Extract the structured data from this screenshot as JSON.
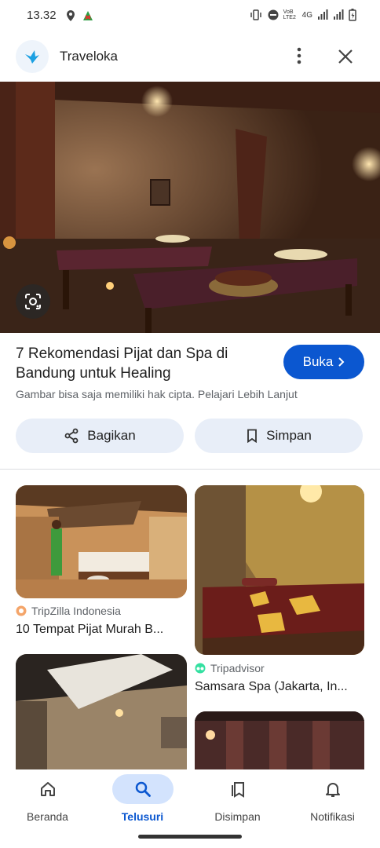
{
  "status_bar": {
    "time": "13.32",
    "network": "4G",
    "volte": "VoB LTE2"
  },
  "header": {
    "site_name": "Traveloka",
    "logo_icon": "traveloka-bird-icon"
  },
  "result": {
    "title": "7 Rekomendasi Pijat dan Spa di Bandung untuk Healing",
    "visit_label": "Buka",
    "copyright_note": "Gambar bisa saja memiliki hak cipta. Pelajari Lebih Lanjut",
    "share_label": "Bagikan",
    "save_label": "Simpan"
  },
  "related": [
    {
      "source": "TripZilla Indonesia",
      "title": "10 Tempat Pijat Murah B...",
      "source_color": "#f4a56a"
    },
    {
      "source": "Tripadvisor",
      "title": "Samsara Spa (Jakarta, In...",
      "source_color": "#34e0a1"
    }
  ],
  "bottom_nav": [
    {
      "label": "Beranda",
      "icon": "home-icon"
    },
    {
      "label": "Telusuri",
      "icon": "search-icon"
    },
    {
      "label": "Disimpan",
      "icon": "saved-icon"
    },
    {
      "label": "Notifikasi",
      "icon": "bell-icon"
    }
  ],
  "colors": {
    "accent": "#0b57d0",
    "pill": "#e8eef8",
    "active_nav": "#d3e3fd"
  }
}
